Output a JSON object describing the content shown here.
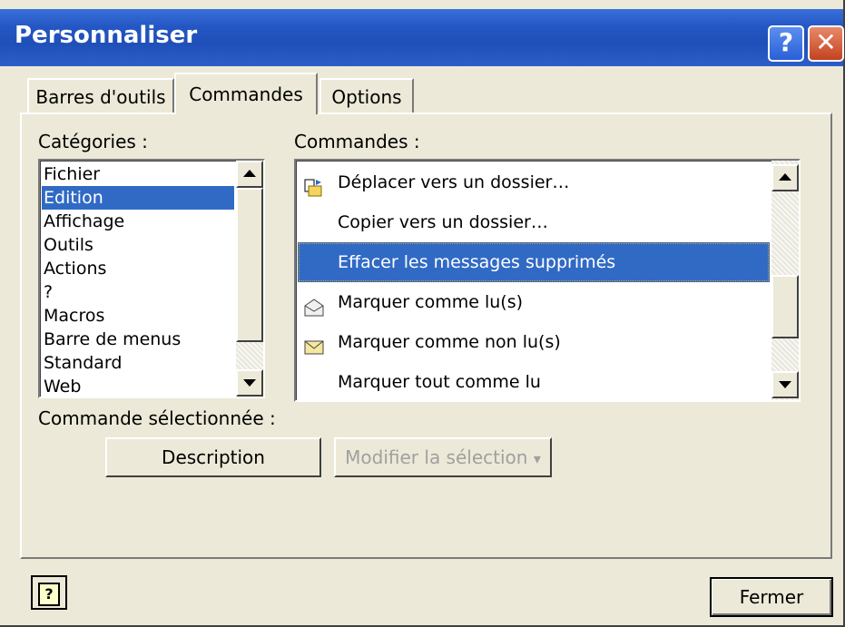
{
  "window": {
    "title": "Personnaliser",
    "help_glyph": "?",
    "close_glyph": "✕"
  },
  "tabs": [
    {
      "label": "Barres d'outils",
      "active": false
    },
    {
      "label": "Commandes",
      "active": true
    },
    {
      "label": "Options",
      "active": false
    }
  ],
  "categories": {
    "label": "Catégories :",
    "items": [
      "Fichier",
      "Edition",
      "Affichage",
      "Outils",
      "Actions",
      "?",
      "Macros",
      "Barre de menus",
      "Standard",
      "Web"
    ],
    "selected": "Edition"
  },
  "commands": {
    "label": "Commandes :",
    "items": [
      {
        "label": "Déplacer vers un dossier…",
        "icon": "move-to-folder-icon"
      },
      {
        "label": "Copier vers un dossier…",
        "icon": ""
      },
      {
        "label": "Effacer les messages supprimés",
        "icon": ""
      },
      {
        "label": "Marquer comme lu(s)",
        "icon": "open-envelope-icon"
      },
      {
        "label": "Marquer comme non lu(s)",
        "icon": "closed-envelope-icon"
      },
      {
        "label": "Marquer tout comme lu",
        "icon": ""
      }
    ],
    "selected": "Effacer les messages supprimés"
  },
  "selected_command": {
    "label": "Commande sélectionnée :",
    "description_button": "Description",
    "modify_button": "Modifier la sélection",
    "modify_arrow": "▾"
  },
  "footer": {
    "help_glyph": "?",
    "close_button": "Fermer"
  },
  "colors": {
    "title_bar": "#2457c4",
    "selection": "#316ac5",
    "face": "#ece9d8"
  }
}
